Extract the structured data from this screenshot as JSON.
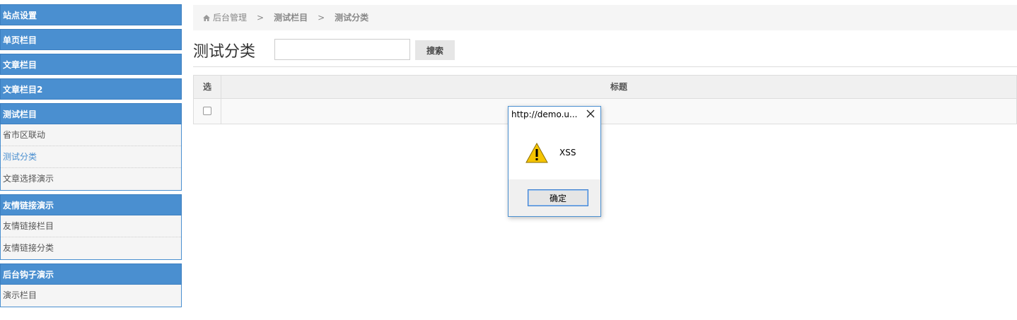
{
  "sidebar": {
    "groups": [
      {
        "title": "站点设置",
        "items": []
      },
      {
        "title": "单页栏目",
        "items": []
      },
      {
        "title": "文章栏目",
        "items": []
      },
      {
        "title": "文章栏目2",
        "items": []
      },
      {
        "title": "测试栏目",
        "items": [
          "省市区联动",
          "测试分类",
          "文章选择演示"
        ]
      },
      {
        "title": "友情链接演示",
        "items": [
          "友情链接栏目",
          "友情链接分类"
        ]
      },
      {
        "title": "后台钩子演示",
        "items": [
          "演示栏目"
        ]
      }
    ]
  },
  "breadcrumb": {
    "home": "后台管理",
    "sep": ">",
    "level1": "测试栏目",
    "level2": "测试分类"
  },
  "page": {
    "title": "测试分类",
    "search_value": "",
    "search_button": "搜索"
  },
  "table": {
    "col_select": "选",
    "col_title": "标题"
  },
  "dialog": {
    "title": "http://demo.u...",
    "message": "XSS",
    "ok_button": "确定",
    "icon": "warning-icon"
  },
  "colors": {
    "sidebar_header": "#4a8fd0",
    "active_item": "#4a8fd0"
  }
}
